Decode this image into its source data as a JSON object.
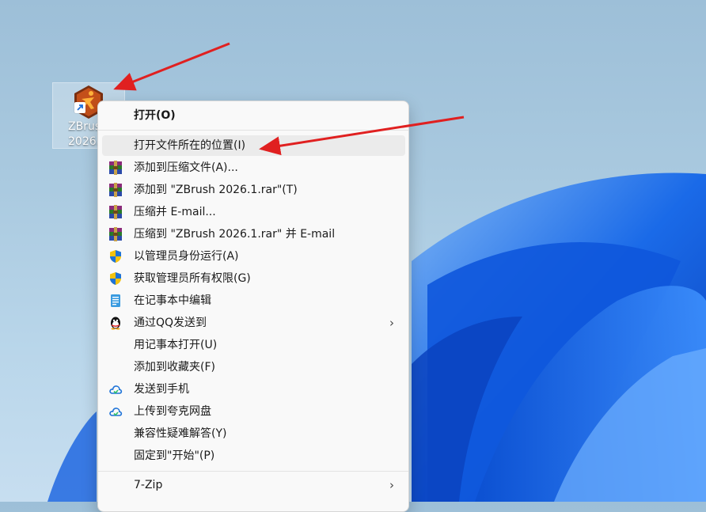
{
  "desktop": {
    "icon_label": "ZBrush 2026.1"
  },
  "menu": {
    "items": [
      {
        "label": "打开(O)",
        "icon": "none",
        "bold": true
      },
      {
        "label": "打开文件所在的位置(I)",
        "icon": "none",
        "highlighted": true
      },
      {
        "label": "添加到压缩文件(A)...",
        "icon": "winrar-icon"
      },
      {
        "label": "添加到 \"ZBrush 2026.1.rar\"(T)",
        "icon": "winrar-icon"
      },
      {
        "label": "压缩并 E-mail...",
        "icon": "winrar-icon"
      },
      {
        "label": "压缩到 \"ZBrush 2026.1.rar\" 并 E-mail",
        "icon": "winrar-icon"
      },
      {
        "label": "以管理员身份运行(A)",
        "icon": "uac-shield-icon"
      },
      {
        "label": "获取管理员所有权限(G)",
        "icon": "uac-shield-icon"
      },
      {
        "label": "在记事本中编辑",
        "icon": "notepad-icon"
      },
      {
        "label": "通过QQ发送到",
        "icon": "qq-penguin-icon",
        "submenu": true
      },
      {
        "label": "用记事本打开(U)",
        "icon": "none"
      },
      {
        "label": "添加到收藏夹(F)",
        "icon": "none"
      },
      {
        "label": "发送到手机",
        "icon": "cloud-icon"
      },
      {
        "label": "上传到夸克网盘",
        "icon": "cloud-icon"
      },
      {
        "label": "兼容性疑难解答(Y)",
        "icon": "none"
      },
      {
        "label": "固定到\"开始\"(P)",
        "icon": "none"
      },
      {
        "label": "7-Zip",
        "icon": "none",
        "submenu": true
      }
    ],
    "submenu_glyph": "›"
  },
  "colors": {
    "arrow": "#e02020",
    "menu_bg": "#f9f9f9",
    "hover_bg": "#ebebeb",
    "wallpaper_blue": "#0a5fe0"
  }
}
